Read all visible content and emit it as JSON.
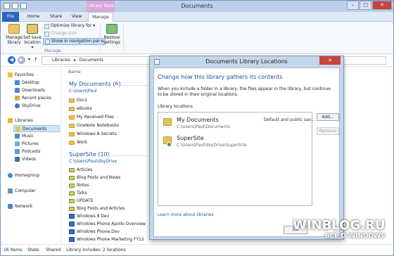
{
  "window": {
    "title": "Documents",
    "context_tab_group": "Library Tools"
  },
  "ribbon": {
    "tabs": [
      "File",
      "Home",
      "Share",
      "View",
      "Manage"
    ],
    "manage_library": "Manage library",
    "manage_library_l1": "Manage",
    "manage_library_l2": "library",
    "set_save_location_l1": "Set save",
    "set_save_location_l2": "location ▾",
    "optimize_library": "Optimize library for ▾",
    "change_icon": "Change icon",
    "show_in_nav": "Show in navigation pane",
    "restore_settings_l1": "Restore",
    "restore_settings_l2": "settings",
    "group_label": "Manage"
  },
  "address": {
    "path": "▸ Libraries ▸ Documents ▸",
    "crumb1": "Libraries",
    "crumb2": "Documents"
  },
  "nav": {
    "favorites": "Favorites",
    "desktop": "Desktop",
    "downloads": "Downloads",
    "recent": "Recent places",
    "skydrive": "SkyDrive",
    "libraries": "Libraries",
    "documents": "Documents",
    "music": "Music",
    "pictures": "Pictures",
    "podcasts": "Podcasts",
    "videos": "Videos",
    "homegroup": "Homegroup",
    "computer": "Computer",
    "network": "Network"
  },
  "content": {
    "col_name": "Name",
    "group1_title": "My Documents (6)",
    "group1_path": "C:\\Users\\Paul",
    "group1_items": [
      "Docs",
      "eBooks",
      "My Received Files",
      "OneNote Notebooks",
      "Windows 8 Secrets",
      "Work"
    ],
    "group2_title": "SuperSite (10)",
    "group2_path": "C:\\Users\\Paul\\SkyDrive",
    "group2_items": [
      "Articles",
      "Blog Posts and News",
      "Notes",
      "Talks",
      "UPDATE",
      "Blog Posts and Articles",
      "Windows 8 Dev",
      "Windows Phone Apollo Overview",
      "Windows Phone.Dev",
      "Windows Phone Marketing FY12"
    ]
  },
  "status": {
    "items": "16 items",
    "state": "State:",
    "state_value": "Shared",
    "library_includes": "Library includes: 2 locations"
  },
  "dialog": {
    "title": "Documents Library Locations",
    "heading": "Change how this library gathers its contents",
    "description": "When you include a folder in a library, the files appear in the library, but continue to be stored in their original locations.",
    "list_label": "Library locations",
    "locations": [
      {
        "name": "My Documents",
        "path": "C:\\Users\\Paul\\Documents",
        "status": "Default and public sav..."
      },
      {
        "name": "SuperSite",
        "path": "C:\\Users\\Paul\\SkyDrive\\SuperSite",
        "status": ""
      }
    ],
    "add_button": "Add...",
    "remove_button": "Remove",
    "link": "Learn more about libraries",
    "ok_button": "OK"
  },
  "watermark": {
    "line1": "WINBLOG.RU",
    "line2": "ВСЁ О WINDOWS"
  },
  "colors": {
    "accent": "#2a66bb",
    "title_bar": "#bcd0ea",
    "library_tools": "#d8a9d9",
    "close": "#c7443c",
    "link": "#1e4fa0"
  }
}
